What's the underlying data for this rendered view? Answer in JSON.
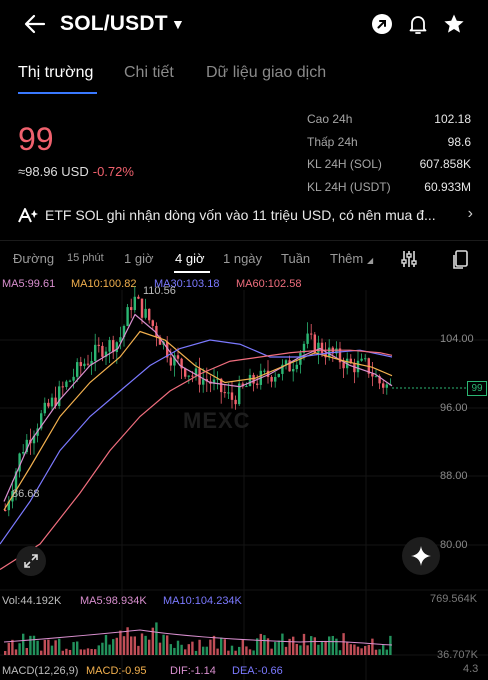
{
  "header": {
    "pair": "SOL/USDT",
    "icons": [
      "back-arrow-icon",
      "caret-down-icon",
      "share-icon",
      "bell-icon",
      "star-icon"
    ]
  },
  "tabs": [
    {
      "label": "Thị trường",
      "active": true
    },
    {
      "label": "Chi tiết",
      "active": false
    },
    {
      "label": "Dữ liệu giao dịch",
      "active": false
    }
  ],
  "price": {
    "last": "99",
    "usd": "≈98.96 USD",
    "change": "-0.72%",
    "color_down": "#f0616d"
  },
  "stats": [
    {
      "label": "Cao 24h",
      "value": "102.18"
    },
    {
      "label": "Thấp 24h",
      "value": "98.6"
    },
    {
      "label": "KL 24H (SOL)",
      "value": "607.858K"
    },
    {
      "label": "KL 24H (USDT)",
      "value": "60.933M"
    }
  ],
  "news": {
    "text": "ETF SOL ghi nhận dòng vốn vào 11 triệu USD, có nên mua đ...",
    "arrow": "›"
  },
  "timeframes": [
    {
      "label": "Đường",
      "active": false
    },
    {
      "label": "15 phút",
      "active": false
    },
    {
      "label": "1 giờ",
      "active": false
    },
    {
      "label": "4 giờ",
      "active": true
    },
    {
      "label": "1 ngày",
      "active": false
    },
    {
      "label": "Tuần",
      "active": false
    },
    {
      "label": "Thêm",
      "active": false
    }
  ],
  "ma_legend": [
    {
      "label": "MA5:99.61",
      "color": "#d98fcf"
    },
    {
      "label": "MA10:100.82",
      "color": "#f2b04e"
    },
    {
      "label": "MA30:103.18",
      "color": "#7b79ff"
    },
    {
      "label": "MA60:102.58",
      "color": "#f06e7e"
    }
  ],
  "chart": {
    "watermark": "MEXC",
    "y_ticks": [
      "104.00",
      "96.00",
      "88.00",
      "80.00"
    ],
    "high_label": "110.56",
    "low_label": "86.68",
    "last_price_tag": "99",
    "up_color": "#2bb673",
    "down_color": "#f0616d"
  },
  "volume": {
    "legend": [
      {
        "label": "Vol:44.192K",
        "color": "#bdbdbd"
      },
      {
        "label": "MA5:98.934K",
        "color": "#d98fcf"
      },
      {
        "label": "MA10:104.234K",
        "color": "#7b79ff"
      }
    ],
    "max_tick": "769.564K",
    "min_tick": "36.707K"
  },
  "macd": {
    "legend": [
      {
        "label": "MACD(12,26,9)",
        "color": "#bdbdbd"
      },
      {
        "label": "MACD:-0.95",
        "color": "#f2b04e"
      },
      {
        "label": "DIF:-1.14",
        "color": "#d98fcf"
      },
      {
        "label": "DEA:-0.66",
        "color": "#7b79ff"
      }
    ],
    "tick": "4.3"
  }
}
